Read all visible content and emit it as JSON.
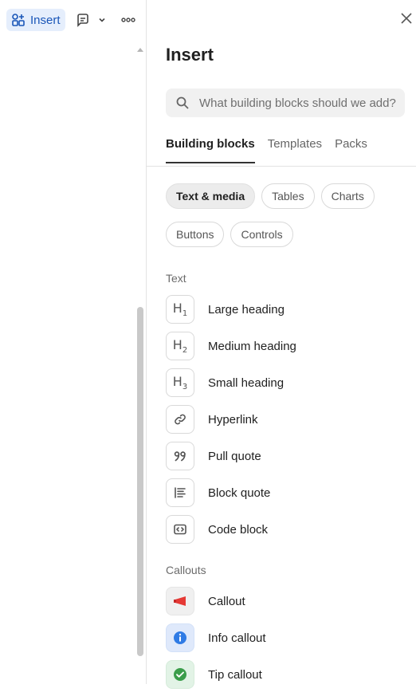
{
  "toolbar": {
    "insert_label": "Insert"
  },
  "panel": {
    "title": "Insert",
    "search_placeholder": "What building blocks should we add?",
    "tabs": [
      {
        "label": "Building blocks",
        "active": true
      },
      {
        "label": "Templates",
        "active": false
      },
      {
        "label": "Packs",
        "active": false
      }
    ],
    "filters": [
      {
        "label": "Text & media",
        "active": true
      },
      {
        "label": "Tables",
        "active": false
      },
      {
        "label": "Charts",
        "active": false
      },
      {
        "label": "Buttons",
        "active": false
      },
      {
        "label": "Controls",
        "active": false
      }
    ],
    "sections": [
      {
        "label": "Text",
        "items": [
          {
            "label": "Large heading",
            "icon": "heading-1-icon"
          },
          {
            "label": "Medium heading",
            "icon": "heading-2-icon"
          },
          {
            "label": "Small heading",
            "icon": "heading-3-icon"
          },
          {
            "label": "Hyperlink",
            "icon": "link-icon"
          },
          {
            "label": "Pull quote",
            "icon": "quote-marks-icon"
          },
          {
            "label": "Block quote",
            "icon": "block-quote-icon"
          },
          {
            "label": "Code block",
            "icon": "code-block-icon"
          }
        ]
      },
      {
        "label": "Callouts",
        "items": [
          {
            "label": "Callout",
            "icon": "megaphone-icon"
          },
          {
            "label": "Info callout",
            "icon": "info-icon"
          },
          {
            "label": "Tip callout",
            "icon": "check-circle-icon"
          }
        ]
      }
    ]
  },
  "colors": {
    "insert_bg": "#e5eefc",
    "insert_fg": "#1a56b8",
    "info_blue": "#2f7be5",
    "tip_green": "#3a9d4a",
    "callout_red": "#e53935"
  }
}
